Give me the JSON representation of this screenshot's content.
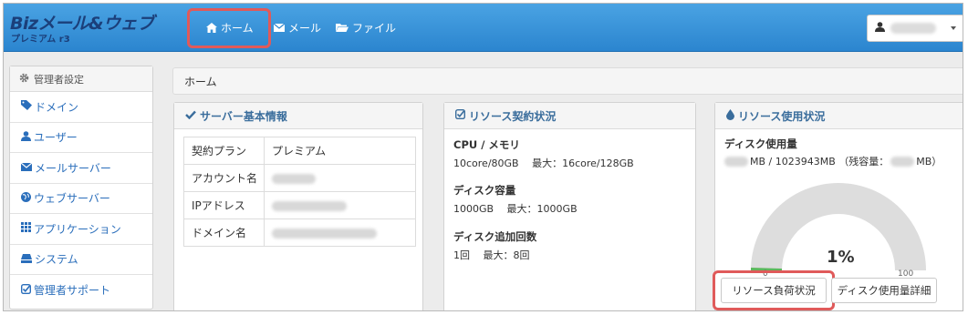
{
  "brand": {
    "name": "Bizメール&ウェブ",
    "edition": "プレミアム r3"
  },
  "nav": {
    "items": [
      {
        "label": "ホーム",
        "icon": "home-icon",
        "active": true
      },
      {
        "label": "メール",
        "icon": "envelope-icon"
      },
      {
        "label": "ファイル",
        "icon": "folder-icon"
      }
    ]
  },
  "user_menu": {
    "icon": "user-icon"
  },
  "sidebar": {
    "heading": "管理者設定",
    "items": [
      {
        "label": "ドメイン",
        "icon": "tag-icon"
      },
      {
        "label": "ユーザー",
        "icon": "user-icon"
      },
      {
        "label": "メールサーバー",
        "icon": "envelope-icon"
      },
      {
        "label": "ウェブサーバー",
        "icon": "globe-icon"
      },
      {
        "label": "アプリケーション",
        "icon": "grid-icon"
      },
      {
        "label": "システム",
        "icon": "drive-icon"
      },
      {
        "label": "管理者サポート",
        "icon": "check-square-icon"
      }
    ]
  },
  "breadcrumb": {
    "current": "ホーム"
  },
  "server_panel": {
    "title": "サーバー基本情報",
    "rows": [
      {
        "key": "契約プラン",
        "value": "プレミアム"
      },
      {
        "key": "アカウント名",
        "value": ""
      },
      {
        "key": "IPアドレス",
        "value": ""
      },
      {
        "key": "ドメイン名",
        "value": ""
      }
    ]
  },
  "contract_panel": {
    "title": "リソース契約状況",
    "cpu": {
      "title": "CPU / メモリ",
      "detail": "10core/80GB　 最大：16core/128GB"
    },
    "disk": {
      "title": "ディスク容量",
      "detail": "1000GB　 最大：1000GB"
    },
    "disk_add": {
      "title": "ディスク追加回数",
      "detail": "1回　 最大：8回"
    }
  },
  "usage_panel": {
    "title": "リソース使用状況",
    "disk_title": "ディスク使用量",
    "disk_used_suffix": "MB / 1023943MB （残容量：",
    "disk_remaining_suffix": "MB）",
    "gauge_label": "1%",
    "gauge_percent": 1,
    "gauge_min": "0",
    "gauge_max": "100",
    "load_button": "リソース負荷状況",
    "detail_button": "ディスク使用量詳細"
  },
  "colors": {
    "header": "#2b85cf",
    "highlight": "#e05a5a",
    "link": "#2a6ebb",
    "gauge_track": "#dddddd",
    "gauge_fill": "#5cb85c"
  }
}
